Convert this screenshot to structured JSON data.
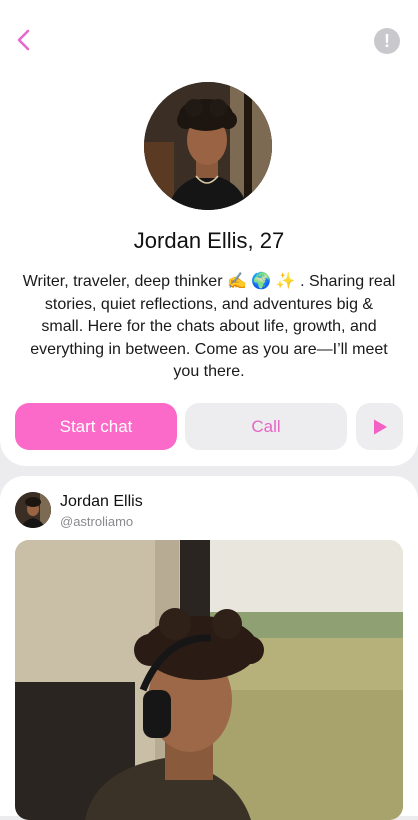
{
  "profile": {
    "name_age": "Jordan Ellis, 27",
    "bio": "Writer, traveler, deep thinker ✍️ 🌍 ✨ . Sharing real stories, quiet reflections, and adventures big & small. Here for the chats about life, growth, and everything in between. Come as you are—I’ll meet you there."
  },
  "actions": {
    "start_chat": "Start chat",
    "call": "Call"
  },
  "post": {
    "author_name": "Jordan Ellis",
    "author_handle": "@astroliamo"
  },
  "colors": {
    "accent": "#fb6ac9",
    "call_text": "#e565c4",
    "secondary_button_bg": "#ededef",
    "page_bg": "#ececef"
  },
  "icons": {
    "back": "chevron-left-icon",
    "report": "exclamation-icon",
    "play": "play-icon"
  }
}
